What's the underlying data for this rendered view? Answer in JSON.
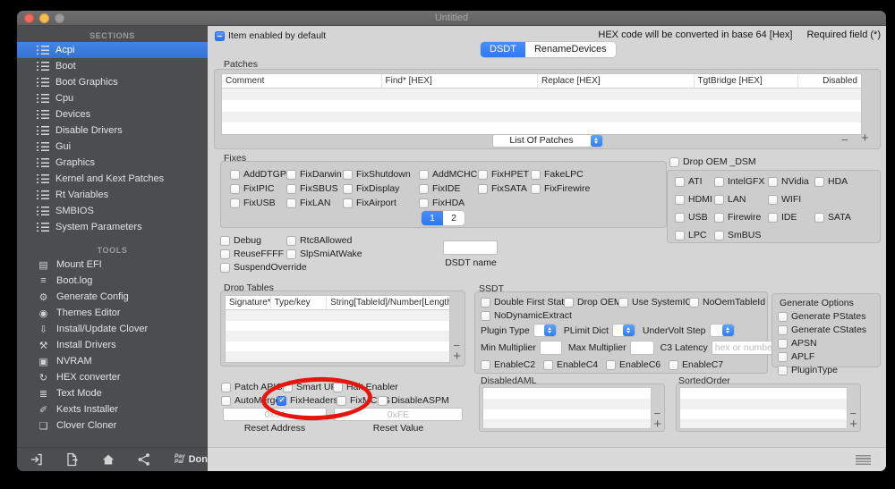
{
  "window": {
    "title": "Untitled"
  },
  "sidebar": {
    "sections_header": "SECTIONS",
    "sections": [
      "Acpi",
      "Boot",
      "Boot Graphics",
      "Cpu",
      "Devices",
      "Disable Drivers",
      "Gui",
      "Graphics",
      "Kernel and Kext Patches",
      "Rt Variables",
      "SMBIOS",
      "System Parameters"
    ],
    "tools_header": "TOOLS",
    "tools": [
      "Mount EFI",
      "Boot.log",
      "Generate Config",
      "Themes Editor",
      "Install/Update Clover",
      "Install Drivers",
      "NVRAM",
      "HEX converter",
      "Text Mode",
      "Kexts Installer",
      "Clover Cloner"
    ],
    "tool_icons": [
      "▤",
      "≡",
      "⚙",
      "◉",
      "⇩",
      "⚒",
      "▣",
      "↻",
      "≣",
      "✐",
      "❏"
    ],
    "paypal_line1": "Pay",
    "paypal_line2": "Pal",
    "donate_label": "Donate"
  },
  "topbar": {
    "enabled_label": "Item enabled by default",
    "hex_note": "HEX code will be converted in base 64 [Hex]",
    "required_note": "Required field (*)"
  },
  "tabs": {
    "dsdt": "DSDT",
    "rename_devices": "RenameDevices"
  },
  "controls": {
    "minus": "−",
    "plus": "+"
  },
  "patches": {
    "label": "Patches",
    "columns": [
      "Comment",
      "Find* [HEX]",
      "Replace [HEX]",
      "TgtBridge [HEX]",
      "Disabled"
    ],
    "dropdown_value": "List Of Patches"
  },
  "fixes": {
    "label": "Fixes",
    "row1": [
      "AddDTGP",
      "FixDarwin",
      "FixShutdown",
      "AddMCHC",
      "FixHPET",
      "FakeLPC"
    ],
    "row2": [
      "FixIPIC",
      "FixSBUS",
      "FixDisplay",
      "FixIDE",
      "FixSATA",
      "FixFirewire"
    ],
    "row3": [
      "FixUSB",
      "FixLAN",
      "FixAirport",
      "FixHDA"
    ],
    "page1": "1",
    "page2": "2"
  },
  "drop_oem": {
    "header": "Drop OEM _DSM",
    "row1": [
      "ATI",
      "IntelGFX",
      "NVidia",
      "HDA"
    ],
    "row2": [
      "HDMI",
      "LAN",
      "WIFI"
    ],
    "row3": [
      "USB",
      "Firewire",
      "IDE",
      "SATA"
    ],
    "row4": [
      "LPC",
      "SmBUS"
    ]
  },
  "debug_group": {
    "col1": [
      "Debug",
      "ReuseFFFF",
      "SuspendOverride"
    ],
    "col2": [
      "Rtc8Allowed",
      "SlpSmiAtWake"
    ],
    "dsdt_name_label": "DSDT name",
    "dsdt_name_value": ""
  },
  "drop_tables": {
    "label": "Drop Tables",
    "columns": [
      "Signature*",
      "Type/key",
      "String[TableId]/Number[Length]"
    ]
  },
  "ssdt": {
    "label": "SSDT",
    "row1": [
      "Double First State",
      "Drop OEM",
      "Use SystemIO",
      "NoOemTableId"
    ],
    "row2": [
      "NoDynamicExtract"
    ],
    "plugin_type_label": "Plugin Type",
    "plimit_dict_label": "PLimit Dict",
    "undervolt_step_label": "UnderVolt Step",
    "min_multiplier_label": "Min Multiplier",
    "max_multiplier_label": "Max Multiplier",
    "c3_latency_label": "C3 Latency",
    "c3_latency_placeholder": "hex or number",
    "row5": [
      "EnableC2",
      "EnableC4",
      "EnableC6",
      "EnableC7"
    ]
  },
  "generate_options": {
    "label": "Generate Options",
    "items": [
      "Generate PStates",
      "Generate CStates",
      "APSN",
      "APLF",
      "PluginType"
    ]
  },
  "apic_group": {
    "row1": [
      "Patch APIC",
      "Smart UPS",
      "Halt Enabler"
    ],
    "row2": [
      "AutoMerge",
      "FixHeaders",
      "FixMCFG",
      "DisableASPM"
    ],
    "checked_item": "FixHeaders",
    "reset_address_placeholder": "0x64",
    "reset_address_label": "Reset Address",
    "reset_value_placeholder": "0xFE",
    "reset_value_label": "Reset Value"
  },
  "lists": {
    "disabled_aml_label": "DisabledAML",
    "sorted_order_label": "SortedOrder"
  },
  "accent": {
    "blue": "#2e7cf6",
    "selection_blue": "#3b7ce0",
    "red_annotation": "#e8150d"
  }
}
